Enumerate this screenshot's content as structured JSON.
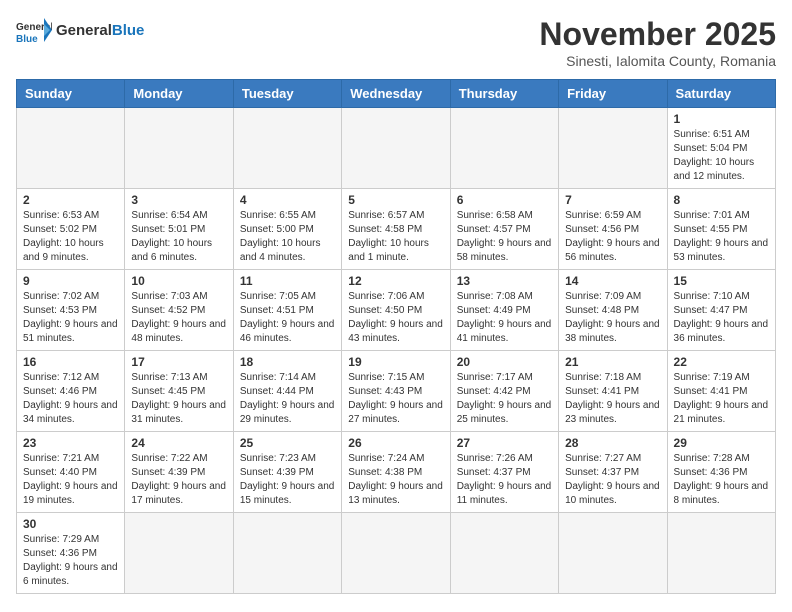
{
  "header": {
    "logo_general": "General",
    "logo_blue": "Blue",
    "month_title": "November 2025",
    "subtitle": "Sinesti, Ialomita County, Romania"
  },
  "days_of_week": [
    "Sunday",
    "Monday",
    "Tuesday",
    "Wednesday",
    "Thursday",
    "Friday",
    "Saturday"
  ],
  "weeks": [
    [
      {
        "day": "",
        "info": ""
      },
      {
        "day": "",
        "info": ""
      },
      {
        "day": "",
        "info": ""
      },
      {
        "day": "",
        "info": ""
      },
      {
        "day": "",
        "info": ""
      },
      {
        "day": "",
        "info": ""
      },
      {
        "day": "1",
        "info": "Sunrise: 6:51 AM\nSunset: 5:04 PM\nDaylight: 10 hours and 12 minutes."
      }
    ],
    [
      {
        "day": "2",
        "info": "Sunrise: 6:53 AM\nSunset: 5:02 PM\nDaylight: 10 hours and 9 minutes."
      },
      {
        "day": "3",
        "info": "Sunrise: 6:54 AM\nSunset: 5:01 PM\nDaylight: 10 hours and 6 minutes."
      },
      {
        "day": "4",
        "info": "Sunrise: 6:55 AM\nSunset: 5:00 PM\nDaylight: 10 hours and 4 minutes."
      },
      {
        "day": "5",
        "info": "Sunrise: 6:57 AM\nSunset: 4:58 PM\nDaylight: 10 hours and 1 minute."
      },
      {
        "day": "6",
        "info": "Sunrise: 6:58 AM\nSunset: 4:57 PM\nDaylight: 9 hours and 58 minutes."
      },
      {
        "day": "7",
        "info": "Sunrise: 6:59 AM\nSunset: 4:56 PM\nDaylight: 9 hours and 56 minutes."
      },
      {
        "day": "8",
        "info": "Sunrise: 7:01 AM\nSunset: 4:55 PM\nDaylight: 9 hours and 53 minutes."
      }
    ],
    [
      {
        "day": "9",
        "info": "Sunrise: 7:02 AM\nSunset: 4:53 PM\nDaylight: 9 hours and 51 minutes."
      },
      {
        "day": "10",
        "info": "Sunrise: 7:03 AM\nSunset: 4:52 PM\nDaylight: 9 hours and 48 minutes."
      },
      {
        "day": "11",
        "info": "Sunrise: 7:05 AM\nSunset: 4:51 PM\nDaylight: 9 hours and 46 minutes."
      },
      {
        "day": "12",
        "info": "Sunrise: 7:06 AM\nSunset: 4:50 PM\nDaylight: 9 hours and 43 minutes."
      },
      {
        "day": "13",
        "info": "Sunrise: 7:08 AM\nSunset: 4:49 PM\nDaylight: 9 hours and 41 minutes."
      },
      {
        "day": "14",
        "info": "Sunrise: 7:09 AM\nSunset: 4:48 PM\nDaylight: 9 hours and 38 minutes."
      },
      {
        "day": "15",
        "info": "Sunrise: 7:10 AM\nSunset: 4:47 PM\nDaylight: 9 hours and 36 minutes."
      }
    ],
    [
      {
        "day": "16",
        "info": "Sunrise: 7:12 AM\nSunset: 4:46 PM\nDaylight: 9 hours and 34 minutes."
      },
      {
        "day": "17",
        "info": "Sunrise: 7:13 AM\nSunset: 4:45 PM\nDaylight: 9 hours and 31 minutes."
      },
      {
        "day": "18",
        "info": "Sunrise: 7:14 AM\nSunset: 4:44 PM\nDaylight: 9 hours and 29 minutes."
      },
      {
        "day": "19",
        "info": "Sunrise: 7:15 AM\nSunset: 4:43 PM\nDaylight: 9 hours and 27 minutes."
      },
      {
        "day": "20",
        "info": "Sunrise: 7:17 AM\nSunset: 4:42 PM\nDaylight: 9 hours and 25 minutes."
      },
      {
        "day": "21",
        "info": "Sunrise: 7:18 AM\nSunset: 4:41 PM\nDaylight: 9 hours and 23 minutes."
      },
      {
        "day": "22",
        "info": "Sunrise: 7:19 AM\nSunset: 4:41 PM\nDaylight: 9 hours and 21 minutes."
      }
    ],
    [
      {
        "day": "23",
        "info": "Sunrise: 7:21 AM\nSunset: 4:40 PM\nDaylight: 9 hours and 19 minutes."
      },
      {
        "day": "24",
        "info": "Sunrise: 7:22 AM\nSunset: 4:39 PM\nDaylight: 9 hours and 17 minutes."
      },
      {
        "day": "25",
        "info": "Sunrise: 7:23 AM\nSunset: 4:39 PM\nDaylight: 9 hours and 15 minutes."
      },
      {
        "day": "26",
        "info": "Sunrise: 7:24 AM\nSunset: 4:38 PM\nDaylight: 9 hours and 13 minutes."
      },
      {
        "day": "27",
        "info": "Sunrise: 7:26 AM\nSunset: 4:37 PM\nDaylight: 9 hours and 11 minutes."
      },
      {
        "day": "28",
        "info": "Sunrise: 7:27 AM\nSunset: 4:37 PM\nDaylight: 9 hours and 10 minutes."
      },
      {
        "day": "29",
        "info": "Sunrise: 7:28 AM\nSunset: 4:36 PM\nDaylight: 9 hours and 8 minutes."
      }
    ],
    [
      {
        "day": "30",
        "info": "Sunrise: 7:29 AM\nSunset: 4:36 PM\nDaylight: 9 hours and 6 minutes."
      },
      {
        "day": "",
        "info": ""
      },
      {
        "day": "",
        "info": ""
      },
      {
        "day": "",
        "info": ""
      },
      {
        "day": "",
        "info": ""
      },
      {
        "day": "",
        "info": ""
      },
      {
        "day": "",
        "info": ""
      }
    ]
  ]
}
